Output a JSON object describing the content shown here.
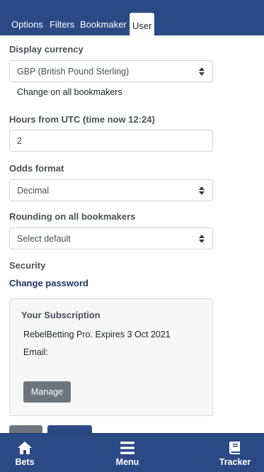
{
  "tabs": [
    {
      "label": "Options",
      "active": false
    },
    {
      "label": "Filters",
      "active": false
    },
    {
      "label": "Bookmaker",
      "active": false
    },
    {
      "label": "User",
      "active": true
    }
  ],
  "currency": {
    "label": "Display currency",
    "value": "GBP (British Pound Sterling)",
    "change_all_link": "Change on all bookmakers"
  },
  "utc": {
    "label": "Hours from UTC (time now 12:24)",
    "value": "2"
  },
  "odds": {
    "label": "Odds format",
    "value": "Decimal"
  },
  "rounding": {
    "label": "Rounding on all bookmakers",
    "value": "Select default"
  },
  "security": {
    "heading": "Security",
    "change_password": "Change password"
  },
  "subscription": {
    "title": "Your Subscription",
    "plan_line": "RebelBetting Pro. Expires 3 Oct 2021",
    "email_label": "Email:",
    "manage_label": "Manage"
  },
  "bottom_nav": [
    {
      "label": "Bets",
      "icon": "home-icon"
    },
    {
      "label": "Menu",
      "icon": "hamburger-icon"
    },
    {
      "label": "Tracker",
      "icon": "book-icon"
    }
  ],
  "colors": {
    "brand_navy": "#2b4a85",
    "secondary_gray": "#6c757d",
    "link_navy": "#1d3461"
  }
}
